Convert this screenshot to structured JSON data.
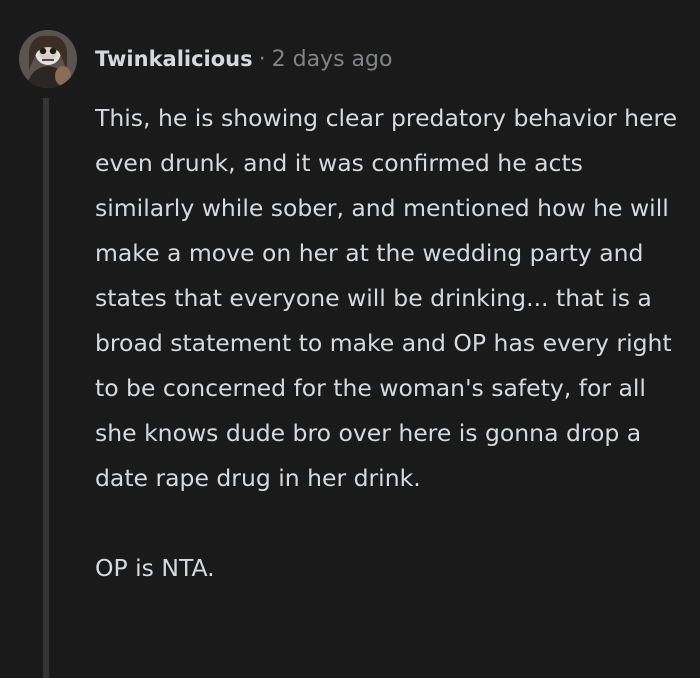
{
  "comment": {
    "username": "Twinkalicious",
    "separator": "·",
    "timestamp": "2 days ago",
    "avatar_icon": "user-avatar-icon",
    "paragraphs": [
      "This, he is showing clear predatory behavior here even drunk, and it was confirmed he acts similarly while sober, and mentioned how he will make a move on her at the wedding party and states that everyone will be drinking... that is a broad statement to make and OP has every right to be concerned for the woman's safety, for all she knows dude bro over here is gonna drop a date rape drug in her drink.",
      "OP is NTA."
    ]
  },
  "colors": {
    "background": "#1a1a1b",
    "text": "#d7dadc",
    "muted": "#818384",
    "thread_line": "#343536"
  }
}
